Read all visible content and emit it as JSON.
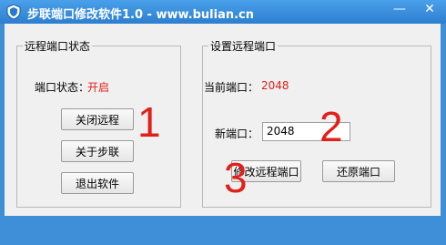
{
  "window": {
    "title": "步联端口修改软件1.0 - www.bulian.cn",
    "minimize_glyph": "—",
    "close_glyph": "✕"
  },
  "remote_status_group": {
    "legend": "远程端口状态",
    "status_label": "端口状态：",
    "status_value": "开启",
    "buttons": {
      "close_remote": "关闭远程",
      "about": "关于步联",
      "exit": "退出软件"
    }
  },
  "settings_group": {
    "legend": "设置远程端口",
    "current_label": "当前端口：",
    "current_value": "2048",
    "new_label": "新端口：",
    "new_value": "2048",
    "buttons": {
      "modify": "修改远程端口",
      "restore": "还原端口"
    }
  },
  "annotations": [
    "1",
    "2",
    "3"
  ],
  "colors": {
    "title_bar": "#3f8fd8",
    "client_bg": "#f0f0f0",
    "status_red": "#e0201a"
  }
}
